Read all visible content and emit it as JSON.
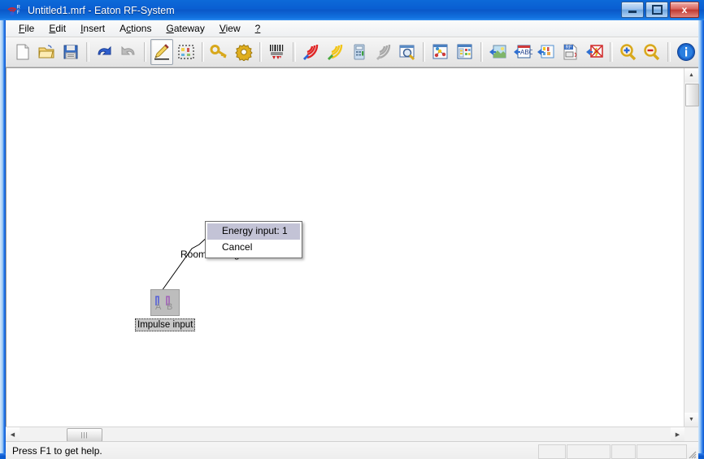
{
  "window": {
    "title": "Untitled1.mrf - Eaton RF-System",
    "app_icon": "rf-app-icon",
    "buttons": {
      "minimize": "minimize-button",
      "maximize": "maximize-button",
      "close_label": "x"
    }
  },
  "menubar": {
    "items": [
      {
        "name": "file",
        "pre": "",
        "key": "F",
        "post": "ile"
      },
      {
        "name": "edit",
        "pre": "",
        "key": "E",
        "post": "dit"
      },
      {
        "name": "insert",
        "pre": "",
        "key": "I",
        "post": "nsert"
      },
      {
        "name": "actions",
        "pre": "A",
        "key": "c",
        "post": "tions"
      },
      {
        "name": "gateway",
        "pre": "",
        "key": "G",
        "post": "ateway"
      },
      {
        "name": "view",
        "pre": "",
        "key": "V",
        "post": "iew"
      },
      {
        "name": "help",
        "pre": "",
        "key": "?",
        "post": ""
      }
    ]
  },
  "toolbar": {
    "buttons": [
      {
        "name": "new-file-icon",
        "tip": "New"
      },
      {
        "name": "open-folder-icon",
        "tip": "Open"
      },
      {
        "name": "save-disk-icon",
        "tip": "Save"
      },
      {
        "name": "undo-arrow-icon",
        "tip": "Undo"
      },
      {
        "name": "redo-arrow-icon",
        "tip": "Redo"
      },
      {
        "name": "pencil-edit-icon",
        "tip": "Edit",
        "active": true
      },
      {
        "name": "select-marquee-icon",
        "tip": "Select"
      },
      {
        "name": "key-icon",
        "tip": "Key"
      },
      {
        "name": "gear-settings-icon",
        "tip": "Settings"
      },
      {
        "name": "barcode-scan-icon",
        "tip": "Barcode"
      },
      {
        "name": "rf-signal-red-icon",
        "tip": "RF red"
      },
      {
        "name": "rf-signal-yellow-icon",
        "tip": "RF yellow"
      },
      {
        "name": "calculator-icon",
        "tip": "Calculator"
      },
      {
        "name": "rf-signal-gray-icon",
        "tip": "RF gray"
      },
      {
        "name": "search-window-icon",
        "tip": "Find"
      },
      {
        "name": "network-diagram-icon",
        "tip": "Topology"
      },
      {
        "name": "list-window-icon",
        "tip": "List"
      },
      {
        "name": "import-image-icon",
        "tip": "Import image"
      },
      {
        "name": "import-image2-icon",
        "tip": "Import image 2"
      },
      {
        "name": "import-abc-icon",
        "tip": "Import text"
      },
      {
        "name": "import-colors-icon",
        "tip": "Import colors"
      },
      {
        "name": "rf-file-icon",
        "tip": "RF file"
      },
      {
        "name": "disable-rf-icon",
        "tip": "Disable RF"
      },
      {
        "name": "zoom-in-icon",
        "tip": "Zoom in"
      },
      {
        "name": "zoom-out-icon",
        "tip": "Zoom out"
      },
      {
        "name": "info-icon",
        "tip": "Info"
      }
    ]
  },
  "canvas": {
    "node": {
      "name": "impulse-input-device",
      "label": "Impulse input",
      "channel_a": "A",
      "channel_b": "B"
    },
    "link_label": "Room-Manager",
    "context_menu": {
      "items": [
        {
          "label": "Energy input: 1",
          "selected": true
        },
        {
          "label": "Cancel",
          "selected": false
        }
      ]
    }
  },
  "scrollbars": {
    "up_arrow": "▲",
    "down_arrow": "▼",
    "left_arrow": "◀",
    "right_arrow": "▶",
    "h_thumb_grip": "|||"
  },
  "statusbar": {
    "text": "Press F1 to get help."
  },
  "colors": {
    "title_blue": "#0a5fd2",
    "frame_blue": "#0b5fd4",
    "menu_highlight": "#c3c3d6",
    "node_fill": "#bdbdbd",
    "label_fill": "#c8c8c8",
    "channel_a": "#5560d8",
    "channel_b": "#a060b8"
  }
}
